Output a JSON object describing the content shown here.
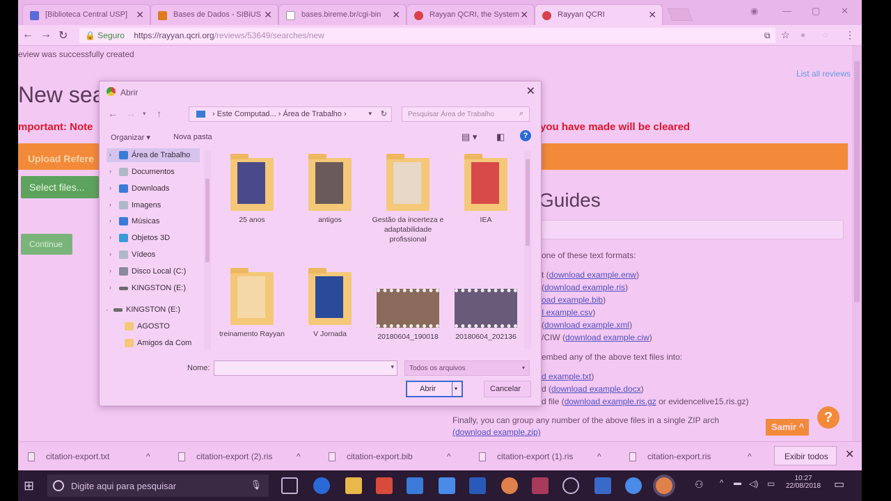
{
  "browser": {
    "tabs": [
      {
        "title": "[Biblioteca Central USP] ",
        "color": "#5a6ad8"
      },
      {
        "title": "Bases de Dados - SIBiUS",
        "color": "#e07a20"
      },
      {
        "title": "bases.bireme.br/cgi-bin",
        "color": "#ffffff"
      },
      {
        "title": "Rayyan QCRI, the System",
        "color": "#d8404a"
      },
      {
        "title": "Rayyan QCRI",
        "color": "#d8404a"
      }
    ],
    "secure_label": "Seguro",
    "url_host": "https://rayyan.qcri.org",
    "url_path": "/reviews/53649/searches/new"
  },
  "page": {
    "flash": "eview was successfully created",
    "list_all": "List all reviews",
    "title": "New sea",
    "important": "mportant: Note",
    "cleared": "you have made will be cleared",
    "upload": "Upload Refere",
    "select_files": "Select files...",
    "continue": "Continue",
    "guides_title": "Guides",
    "guide_lines": [
      {
        "pre": "one of these text formats:",
        "link": "",
        "post": ""
      },
      {
        "pre": "t (",
        "link": "download example.enw",
        "post": ")"
      },
      {
        "pre": "(",
        "link": "download example.ris",
        "post": ")"
      },
      {
        "pre": "",
        "link": "oad example.bib",
        "post": ")"
      },
      {
        "pre": "",
        "link": "I example.csv",
        "post": ")"
      },
      {
        "pre": "(",
        "link": "download example.xml",
        "post": ")"
      },
      {
        "pre": "/CIW (",
        "link": "download example.ciw",
        "post": ")"
      },
      {
        "pre": "embed any of the above text files into:",
        "link": "",
        "post": ""
      },
      {
        "pre": "",
        "link": "d example.txt",
        "post": ")"
      },
      {
        "pre": "d (",
        "link": "download example.docx",
        "post": ")"
      },
      {
        "pre": "d file (",
        "link": "download example.ris.gz",
        "post": " or evidencelive15.ris.gz)"
      }
    ],
    "finally": "Finally, you can group any number of the above files in a single ZIP arch",
    "finally_link": "(download example.zip)",
    "help_label": "?",
    "samir": "Samir ^"
  },
  "dialog": {
    "title": "Abrir",
    "breadcrumb": [
      "Este Computad...",
      "Área de Trabalho"
    ],
    "search_placeholder": "Pesquisar Área de Trabalho",
    "organizar": "Organizar ▾",
    "nova_pasta": "Nova pasta",
    "tree": [
      {
        "label": "Área de Trabalho",
        "color": "#3a7ad8",
        "selected": true
      },
      {
        "label": "Documentos",
        "color": "#b0b8c8"
      },
      {
        "label": "Downloads",
        "color": "#3a7ad8"
      },
      {
        "label": "Imagens",
        "color": "#b0b8c8"
      },
      {
        "label": "Músicas",
        "color": "#3a7ad8"
      },
      {
        "label": "Objetos 3D",
        "color": "#3a9ad8"
      },
      {
        "label": "Vídeos",
        "color": "#b0b8c8"
      },
      {
        "label": "Disco Local (C:)",
        "color": "#8a8a9a"
      },
      {
        "label": "KINGSTON (E:)",
        "color": "#6a6a6a"
      },
      {
        "label": "KINGSTON (E:)",
        "color": "#6a6a6a"
      },
      {
        "label": "AGOSTO",
        "color": "#f4c878"
      },
      {
        "label": "Amigos da Com",
        "color": "#f4c878"
      }
    ],
    "files": [
      {
        "name": "25 anos",
        "kind": "folder",
        "inner": "#4a4a8a"
      },
      {
        "name": "antigos",
        "kind": "folder",
        "inner": "#6a5a5a"
      },
      {
        "name": "Gestão da incerteza e adaptabilidade profissional",
        "kind": "folder",
        "inner": "#e8d8c8"
      },
      {
        "name": "IEA",
        "kind": "folder",
        "inner": "#d84a4a"
      },
      {
        "name": "treinamento Rayyan",
        "kind": "folder",
        "inner": "#f4d8a8"
      },
      {
        "name": "V Jornada",
        "kind": "folder",
        "inner": "#2a4a9a"
      },
      {
        "name": "20180604_190018",
        "kind": "video",
        "inner": "#8a6a5a"
      },
      {
        "name": "20180604_202136",
        "kind": "video",
        "inner": "#6a5a7a"
      }
    ],
    "nome_label": "Nome:",
    "nome_value": "",
    "filetype": "Todos os arquivos",
    "open": "Abrir",
    "cancel": "Cancelar"
  },
  "downloads": {
    "items": [
      "citation-export.txt",
      "citation-export (2).ris",
      "citation-export.bib",
      "citation-export (1).ris",
      "citation-export.ris"
    ],
    "show_all": "Exibir todos"
  },
  "taskbar": {
    "search_placeholder": "Digite aqui para pesquisar",
    "time": "10:27",
    "date": "22/08/2018"
  }
}
